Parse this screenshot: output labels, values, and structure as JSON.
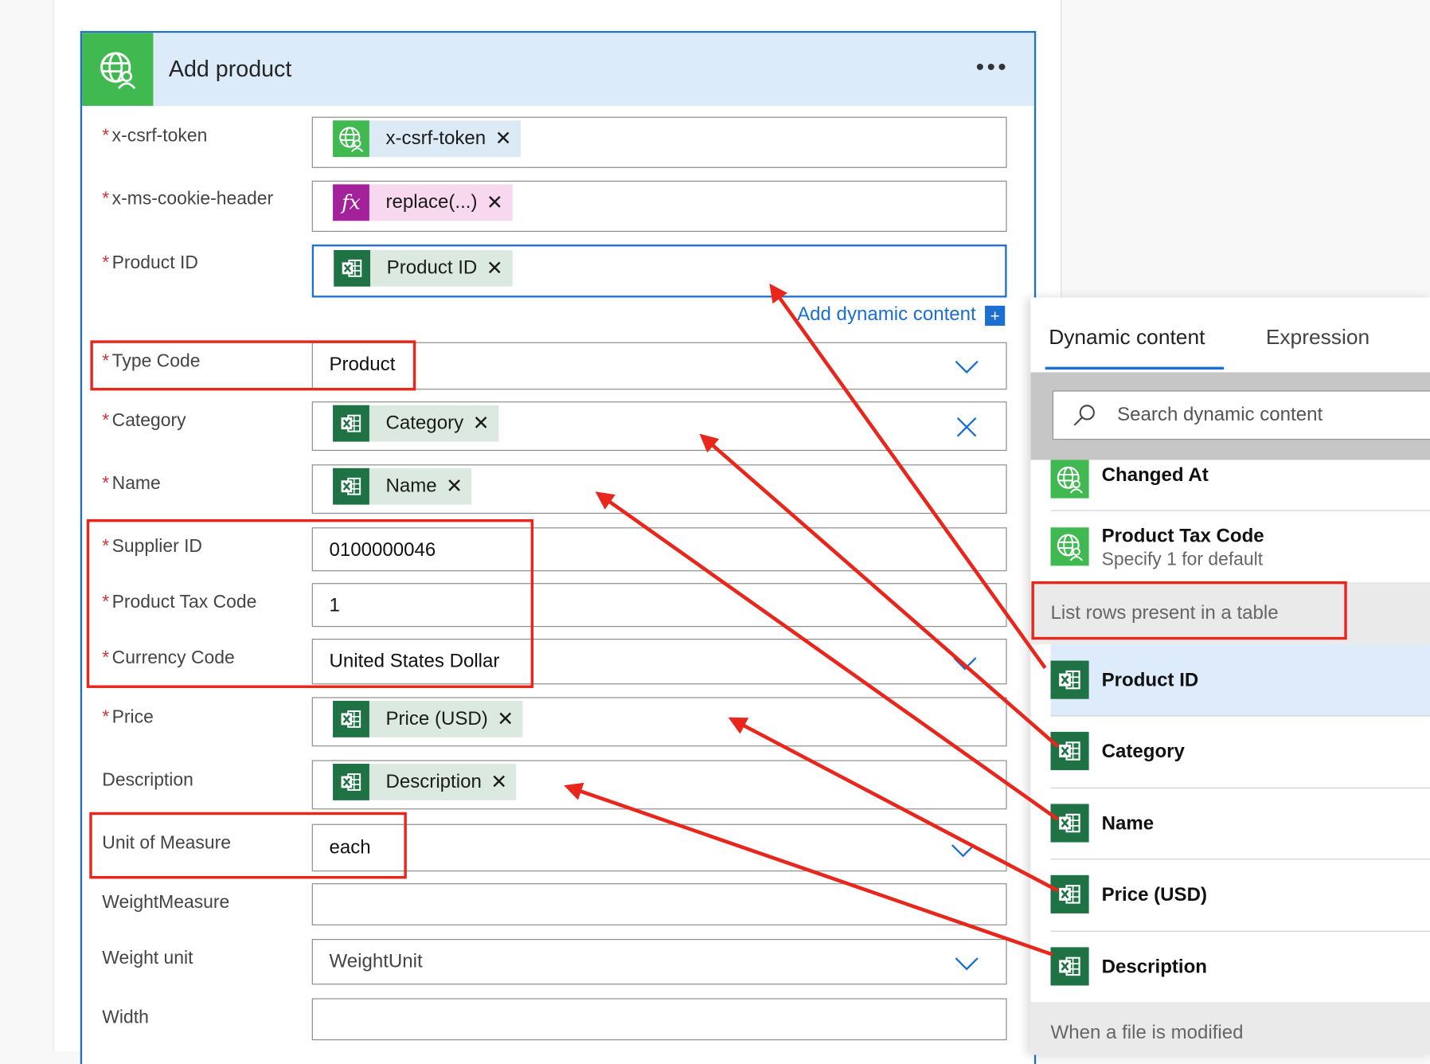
{
  "action_card": {
    "title": "Add product",
    "menu_icon": "ellipsis-icon",
    "header_icon": "web-service-icon"
  },
  "fields": {
    "csrf_token": {
      "label": "x-csrf-token",
      "required": "*",
      "token": "x-csrf-token"
    },
    "cookie_header": {
      "label": "x-ms-cookie-header",
      "required": "*",
      "token": "replace(...)",
      "token_icon": "fx"
    },
    "product_id": {
      "label": "Product ID",
      "required": "*",
      "token": "Product ID"
    },
    "type_code": {
      "label": "Type Code",
      "required": "*",
      "value": "Product"
    },
    "category": {
      "label": "Category",
      "required": "*",
      "token": "Category"
    },
    "name": {
      "label": "Name",
      "required": "*",
      "token": "Name"
    },
    "supplier_id": {
      "label": "Supplier ID",
      "required": "*",
      "value": "0100000046"
    },
    "product_tax_code": {
      "label": "Product Tax Code",
      "required": "*",
      "value": "1"
    },
    "currency_code": {
      "label": "Currency Code",
      "required": "*",
      "value": "United States Dollar"
    },
    "price": {
      "label": "Price",
      "required": "*",
      "token": "Price (USD)"
    },
    "description": {
      "label": "Description",
      "token": "Description"
    },
    "unit_of_measure": {
      "label": "Unit of Measure",
      "value": "each"
    },
    "weight_measure": {
      "label": "WeightMeasure",
      "value": ""
    },
    "weight_unit": {
      "label": "Weight unit",
      "placeholder": "WeightUnit"
    },
    "width": {
      "label": "Width",
      "value": ""
    }
  },
  "add_dynamic_content": {
    "label": "Add dynamic content",
    "plus": "+"
  },
  "dynamic_panel": {
    "tabs": [
      "Dynamic content",
      "Expression"
    ],
    "search_placeholder": "Search dynamic content",
    "items_top": [
      {
        "title": "Changed At",
        "icon": "web-service-icon"
      },
      {
        "title": "Product Tax Code",
        "subtitle": "Specify 1 for default",
        "icon": "web-service-icon"
      }
    ],
    "group_list_rows": "List rows present in a table",
    "items_excel": [
      {
        "title": "Product ID",
        "icon": "excel-icon"
      },
      {
        "title": "Category",
        "icon": "excel-icon"
      },
      {
        "title": "Name",
        "icon": "excel-icon"
      },
      {
        "title": "Price (USD)",
        "icon": "excel-icon"
      },
      {
        "title": "Description",
        "icon": "excel-icon"
      }
    ],
    "group_file_modified": "When a file is modified"
  },
  "colors": {
    "accent_blue": "#1a6fd1",
    "header_bg": "#dbebf9",
    "excel_green": "#1f7244",
    "web_green": "#3fb950",
    "fx_purple": "#a3229b",
    "annotation_red": "#e8261b"
  }
}
